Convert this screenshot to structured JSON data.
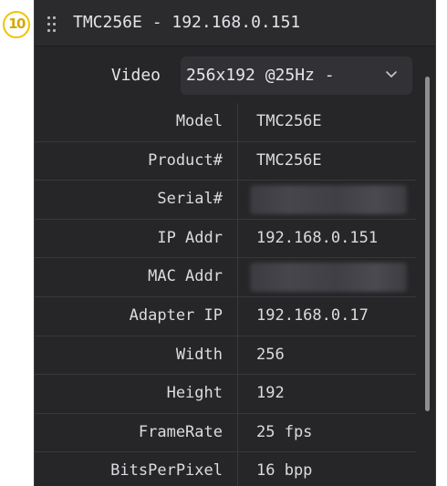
{
  "badge": {
    "label": "10"
  },
  "titlebar": {
    "title": "TMC256E - 192.168.0.151",
    "drag_icon": "drag-handle-icon"
  },
  "video": {
    "label": "Video",
    "selected": "256x192 @25Hz -",
    "chevron_icon": "chevron-down-icon"
  },
  "properties": [
    {
      "label": "Model",
      "value": "TMC256E",
      "blurred": false
    },
    {
      "label": "Product#",
      "value": "TMC256E",
      "blurred": false
    },
    {
      "label": "Serial#",
      "value": "",
      "blurred": true
    },
    {
      "label": "IP Addr",
      "value": "192.168.0.151",
      "blurred": false
    },
    {
      "label": "MAC Addr",
      "value": "",
      "blurred": true
    },
    {
      "label": "Adapter IP",
      "value": "192.168.0.17",
      "blurred": false
    },
    {
      "label": "Width",
      "value": "256",
      "blurred": false
    },
    {
      "label": "Height",
      "value": "192",
      "blurred": false
    },
    {
      "label": "FrameRate",
      "value": "25 fps",
      "blurred": false
    },
    {
      "label": "BitsPerPixel",
      "value": "16 bpp",
      "blurred": false
    }
  ],
  "colors": {
    "panel_bg": "#262628",
    "titlebar_bg": "#2b2b2e",
    "badge_accent": "#f0c300"
  }
}
